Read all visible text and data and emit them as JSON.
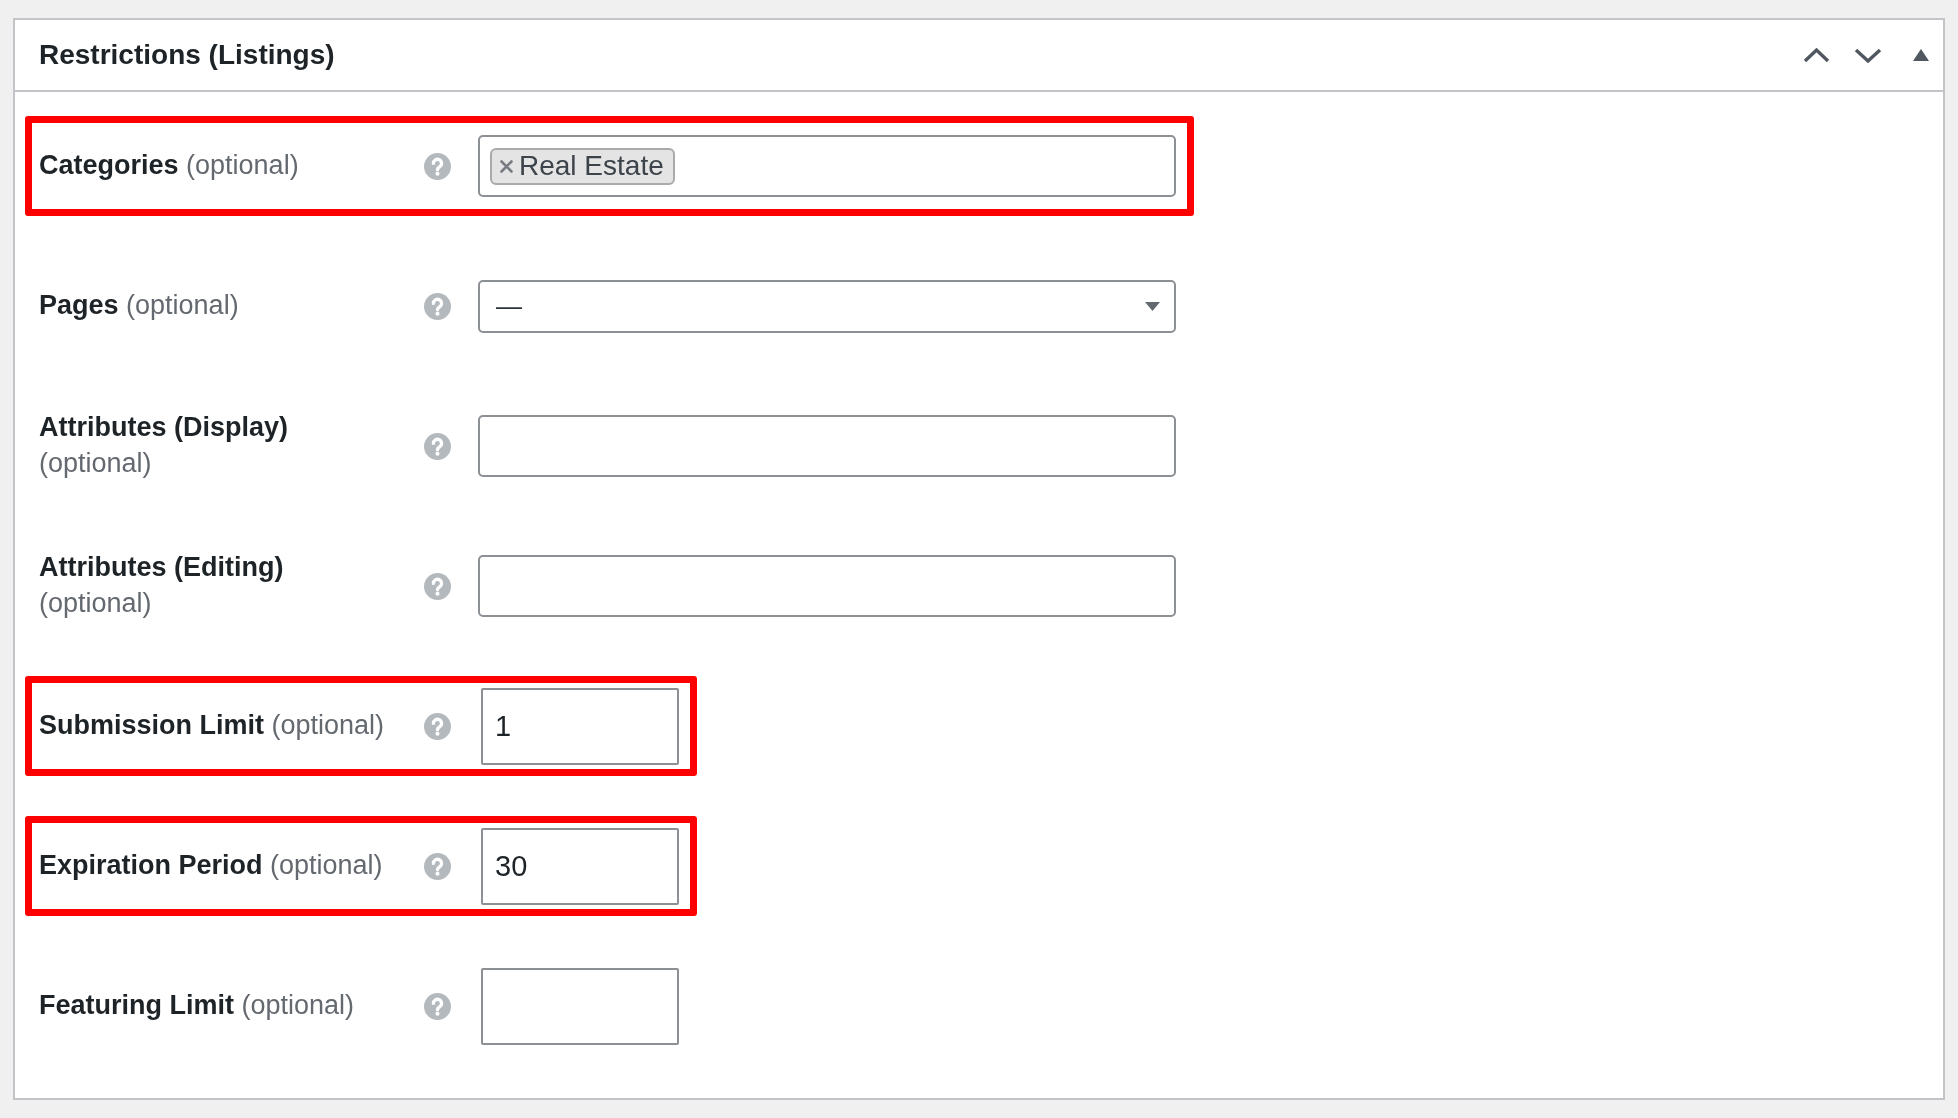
{
  "panel": {
    "title": "Restrictions (Listings)"
  },
  "fields": [
    {
      "label": "Categories",
      "hint": "(optional)",
      "kind": "tags",
      "tags": [
        "Real Estate"
      ],
      "highlighted": true
    },
    {
      "label": "Pages",
      "hint": "(optional)",
      "kind": "select",
      "value": "—",
      "highlighted": false
    },
    {
      "label": "Attributes (Display)",
      "hint": "(optional)",
      "kind": "text",
      "highlighted": false
    },
    {
      "label": "Attributes (Editing)",
      "hint": "(optional)",
      "kind": "text",
      "highlighted": false
    },
    {
      "label": "Submission Limit",
      "hint": "(optional)",
      "kind": "number",
      "value": "1",
      "highlighted": true
    },
    {
      "label": "Expiration Period",
      "hint": "(optional)",
      "kind": "number",
      "value": "30",
      "highlighted": true
    },
    {
      "label": "Featuring Limit",
      "hint": "(optional)",
      "kind": "number",
      "highlighted": false
    }
  ]
}
